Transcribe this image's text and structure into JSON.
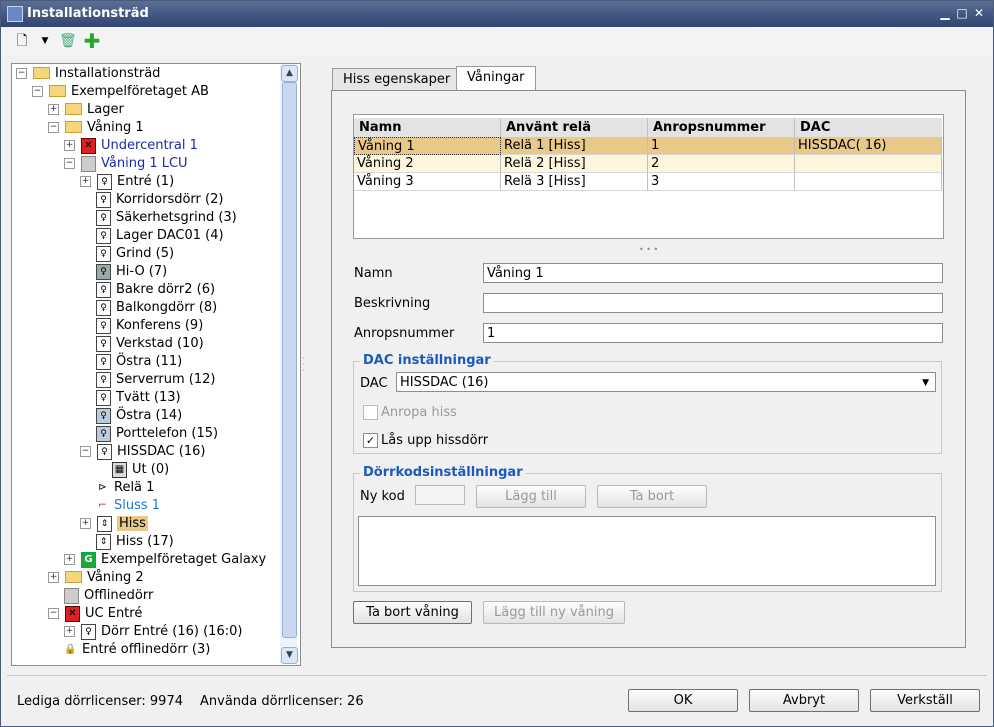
{
  "window": {
    "title": "Installationsträd"
  },
  "tree": {
    "items": [
      {
        "label": "Installationsträd"
      },
      {
        "label": "Exempelföretaget AB"
      },
      {
        "label": "Lager"
      },
      {
        "label": "Våning 1"
      },
      {
        "label": "Undercentral 1"
      },
      {
        "label": "Våning 1 LCU"
      },
      {
        "label": "Entré (1)"
      },
      {
        "label": "Korridorsdörr (2)"
      },
      {
        "label": "Säkerhetsgrind (3)"
      },
      {
        "label": "Lager DAC01 (4)"
      },
      {
        "label": "Grind (5)"
      },
      {
        "label": "Hi-O (7)"
      },
      {
        "label": "Bakre dörr2 (6)"
      },
      {
        "label": "Balkongdörr (8)"
      },
      {
        "label": "Konferens (9)"
      },
      {
        "label": "Verkstad (10)"
      },
      {
        "label": "Östra (11)"
      },
      {
        "label": "Serverrum (12)"
      },
      {
        "label": "Tvätt (13)"
      },
      {
        "label": "Östra (14)"
      },
      {
        "label": "Porttelefon (15)"
      },
      {
        "label": "HISSDAC (16)"
      },
      {
        "label": "Ut (0)"
      },
      {
        "label": "Relä 1"
      },
      {
        "label": "Sluss 1"
      },
      {
        "label": "Hiss"
      },
      {
        "label": "Hiss (17)"
      },
      {
        "label": "Exempelföretaget Galaxy"
      },
      {
        "label": "Våning 2"
      },
      {
        "label": "Offlinedörr"
      },
      {
        "label": "UC Entré"
      },
      {
        "label": "Dörr Entré (16) (16:0)"
      },
      {
        "label": "Entré offlinedörr (3)"
      }
    ]
  },
  "tabs": [
    {
      "label": "Hiss egenskaper"
    },
    {
      "label": "Våningar"
    }
  ],
  "grid": {
    "columns": [
      "Namn",
      "Använt relä",
      "Anropsnummer",
      "DAC"
    ],
    "rows": [
      [
        "Våning 1",
        "Relä 1 [Hiss]",
        "1",
        "HISSDAC( 16)"
      ],
      [
        "Våning 2",
        "Relä 2 [Hiss]",
        "2",
        ""
      ],
      [
        "Våning 3",
        "Relä 3 [Hiss]",
        "3",
        ""
      ]
    ]
  },
  "form": {
    "namn_label": "Namn",
    "namn_value": "Våning 1",
    "beskrivning_label": "Beskrivning",
    "beskrivning_value": "",
    "anrop_label": "Anropsnummer",
    "anrop_value": "1"
  },
  "dac": {
    "group_title": "DAC inställningar",
    "dac_label": "DAC",
    "dac_value": "HISSDAC (16)",
    "anropa_label": "Anropa hiss",
    "las_label": "Lås upp hissdörr"
  },
  "door": {
    "group_title": "Dörrkodsinställningar",
    "nykod_label": "Ny kod",
    "add_label": "Lägg till",
    "remove_label": "Ta bort"
  },
  "buttons": {
    "remove_floor": "Ta bort våning",
    "add_floor": "Lägg till ny våning",
    "ok": "OK",
    "cancel": "Avbryt",
    "apply": "Verkställ"
  },
  "status": {
    "free": "Lediga dörrlicenser: 9974",
    "used": "Använda dörrlicenser: 26"
  }
}
